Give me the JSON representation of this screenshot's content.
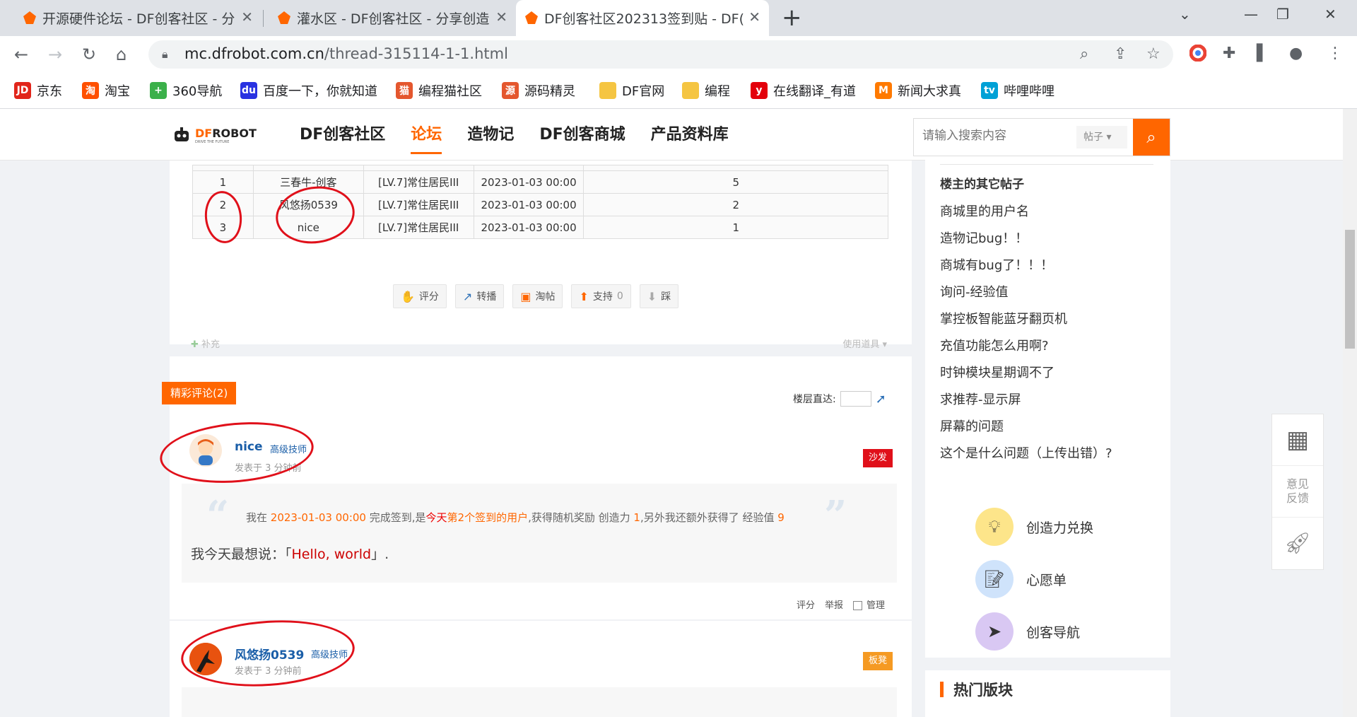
{
  "browser": {
    "tabs": [
      {
        "title": "开源硬件论坛 - DF创客社区 - 分"
      },
      {
        "title": "灌水区 - DF创客社区 - 分享创造"
      },
      {
        "title": "DF创客社区202313签到贴 - DF("
      }
    ],
    "url_host": "mc.dfrobot.com.cn",
    "url_path": "/thread-315114-1-1.html",
    "bookmarks": [
      {
        "label": "京东",
        "icon": "JD",
        "color": "#e1251b"
      },
      {
        "label": "淘宝",
        "icon": "淘",
        "color": "#ff5000"
      },
      {
        "label": "360导航",
        "icon": "+",
        "color": "#3bb04a"
      },
      {
        "label": "百度一下，你就知道",
        "icon": "du",
        "color": "#2932e1"
      },
      {
        "label": "编程猫社区",
        "icon": "猫",
        "color": "#e4572e"
      },
      {
        "label": "源码精灵",
        "icon": "源",
        "color": "#e4572e"
      },
      {
        "label": "DF官网",
        "icon": "",
        "color": "#f5c542"
      },
      {
        "label": "编程",
        "icon": "",
        "color": "#f5c542"
      },
      {
        "label": "在线翻译_有道",
        "icon": "y",
        "color": "#e3000b"
      },
      {
        "label": "新闻大求真",
        "icon": "M",
        "color": "#ff7a00"
      },
      {
        "label": "哔哩哔哩",
        "icon": "tv",
        "color": "#00a1d6"
      }
    ]
  },
  "site": {
    "logo_text_a": "DF",
    "logo_text_b": "ROBOT",
    "logo_tagline": "DRIVE THE FUTURE",
    "nav": [
      "DF创客社区",
      "论坛",
      "造物记",
      "DF创客商城",
      "产品资料库"
    ],
    "search_placeholder": "请输入搜索内容",
    "search_scope": "帖子",
    "accent": "#ff6600"
  },
  "signin_table": {
    "rows": [
      {
        "rank": "1",
        "name": "三春牛-创客",
        "level": "[LV.7]常住居民III",
        "time": "2023-01-03 00:00",
        "days": "5"
      },
      {
        "rank": "2",
        "name": "风悠扬0539",
        "level": "[LV.7]常住居民III",
        "time": "2023-01-03 00:00",
        "days": "2"
      },
      {
        "rank": "3",
        "name": "nice",
        "level": "[LV.7]常住居民III",
        "time": "2023-01-03 00:00",
        "days": "1"
      }
    ]
  },
  "actions": {
    "rate": "评分",
    "forward": "转播",
    "taobao": "淘帖",
    "support": "支持",
    "support_count": "0",
    "oppose": "踩",
    "supplement": "补充",
    "use_item": "使用道具"
  },
  "comments": {
    "badge": "精彩评论(2)",
    "jump_label": "楼层直达:"
  },
  "posts": [
    {
      "user": "nice",
      "level": "高级技师",
      "time": "发表于 3 分钟前",
      "floor": "沙发",
      "floor_color": "#e0101a",
      "q_pre": "我在",
      "q_time": "2023-01-03 00:00",
      "q_mid1": "完成签到,是",
      "q_today": "今天",
      "q_rank": "第2个签到的用户",
      "q_mid2": ",获得随机奖励 创造力",
      "q_create": "1",
      "q_mid3": ",另外我还额外获得了 经验值",
      "q_exp": "9",
      "msg_pre": "我今天最想说：「",
      "msg_hl": "Hello, world",
      "msg_post": "」."
    },
    {
      "user": "风悠扬0539",
      "level": "高级技师",
      "time": "发表于 3 分钟前",
      "floor": "板凳",
      "floor_color": "#f59a23"
    }
  ],
  "post_ops": {
    "rate": "评分",
    "report": "举报",
    "manage": "管理"
  },
  "sidebar": {
    "title": "楼主的其它帖子",
    "threads": [
      "商城里的用户名",
      "造物记bug！！",
      "商城有bug了！！！",
      "询问-经验值",
      "掌控板智能蓝牙翻页机",
      "充值功能怎么用啊?",
      "时钟模块星期调不了",
      "求推荐-显示屏",
      "屏幕的问题",
      "这个是什么问题（上传出错）?"
    ],
    "quick": [
      {
        "label": "创造力兑换",
        "icon": "bulb-icon",
        "color": "#fde58a"
      },
      {
        "label": "心愿单",
        "icon": "notepad-icon",
        "color": "#cfe3fb"
      },
      {
        "label": "创客导航",
        "icon": "compass-icon",
        "color": "#d9c8f3"
      }
    ],
    "hot_title": "热门版块"
  },
  "floating": {
    "feedback_line1": "意见",
    "feedback_line2": "反馈"
  }
}
